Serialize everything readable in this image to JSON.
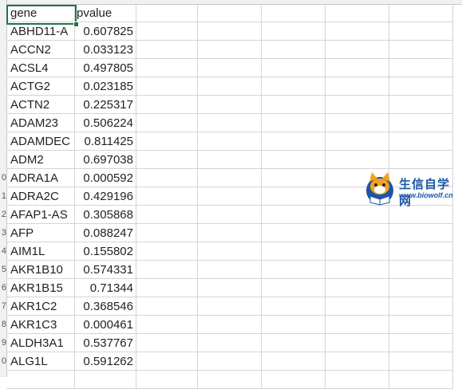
{
  "spreadsheet": {
    "headers": {
      "gene": "gene",
      "pvalue": "pvalue"
    },
    "rows": [
      {
        "gene": "ABHD11-A",
        "pvalue": "0.607825"
      },
      {
        "gene": "ACCN2",
        "pvalue": "0.033123"
      },
      {
        "gene": "ACSL4",
        "pvalue": "0.497805"
      },
      {
        "gene": "ACTG2",
        "pvalue": "0.023185"
      },
      {
        "gene": "ACTN2",
        "pvalue": "0.225317"
      },
      {
        "gene": "ADAM23",
        "pvalue": "0.506224"
      },
      {
        "gene": "ADAMDEC",
        "pvalue": "0.811425"
      },
      {
        "gene": "ADM2",
        "pvalue": "0.697038"
      },
      {
        "gene": "ADRA1A",
        "pvalue": "0.000592"
      },
      {
        "gene": "ADRA2C",
        "pvalue": "0.429196"
      },
      {
        "gene": "AFAP1-AS",
        "pvalue": "0.305868"
      },
      {
        "gene": "AFP",
        "pvalue": "0.088247"
      },
      {
        "gene": "AIM1L",
        "pvalue": "0.155802"
      },
      {
        "gene": "AKR1B10",
        "pvalue": "0.574331"
      },
      {
        "gene": "AKR1B15",
        "pvalue": "0.71344"
      },
      {
        "gene": "AKR1C2",
        "pvalue": "0.368546"
      },
      {
        "gene": "AKR1C3",
        "pvalue": "0.000461"
      },
      {
        "gene": "ALDH3A1",
        "pvalue": "0.537767"
      },
      {
        "gene": "ALG1L",
        "pvalue": "0.591262"
      },
      {
        "gene": "",
        "pvalue": ""
      }
    ],
    "row_numbers": [
      "",
      "",
      "",
      "",
      "",
      "",
      "",
      "",
      "",
      "0",
      "1",
      "2",
      "3",
      "4",
      "5",
      "6",
      "7",
      "8",
      "9",
      "0",
      ""
    ]
  },
  "watermark": {
    "title": "生信自学网",
    "url": "www.biowolf.cn"
  }
}
